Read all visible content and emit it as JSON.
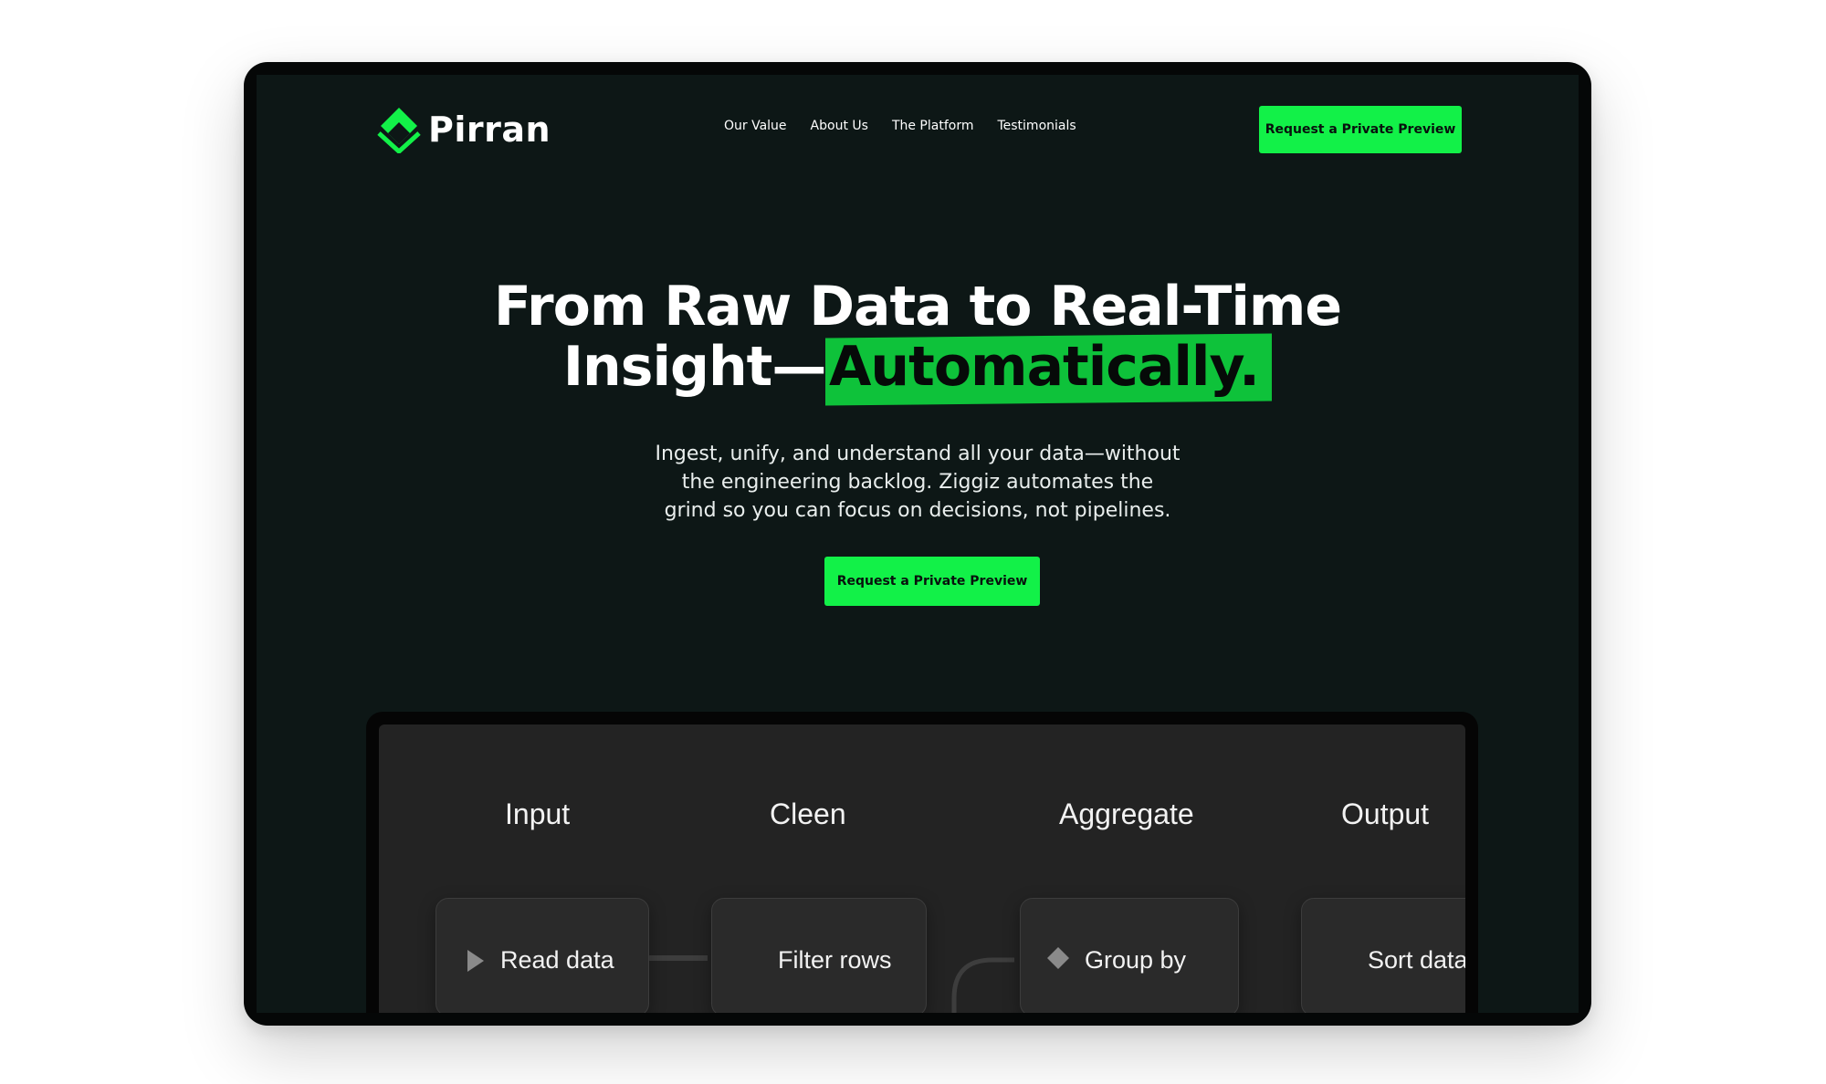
{
  "brand": {
    "name": "Pirran",
    "accent": "#12f148",
    "logo_icon": "diamond-logo-icon"
  },
  "nav": {
    "items": [
      "Our Value",
      "About Us",
      "The Platform",
      "Testimonials"
    ],
    "cta_label": "Request a Private Preview"
  },
  "hero": {
    "title_line1": "From Raw Data to Real-Time",
    "title_line2_prefix": "Insight—",
    "title_highlight": "Automatically.",
    "subtitle_lines": [
      "Ingest, unify, and understand all your data—without",
      "the engineering backlog. Ziggiz automates the",
      "grind so you can focus on decisions, not pipelines."
    ],
    "cta_label": "Request a Private Preview"
  },
  "pipeline": {
    "stages": [
      "Input",
      "Cleen",
      "Aggregate",
      "Output"
    ],
    "nodes": [
      {
        "label": "Read data",
        "icon": "play-icon"
      },
      {
        "label": "Filter rows",
        "icon": ""
      },
      {
        "label": "Group by",
        "icon": "diamond-icon"
      },
      {
        "label": "Sort data",
        "icon": ""
      }
    ]
  }
}
